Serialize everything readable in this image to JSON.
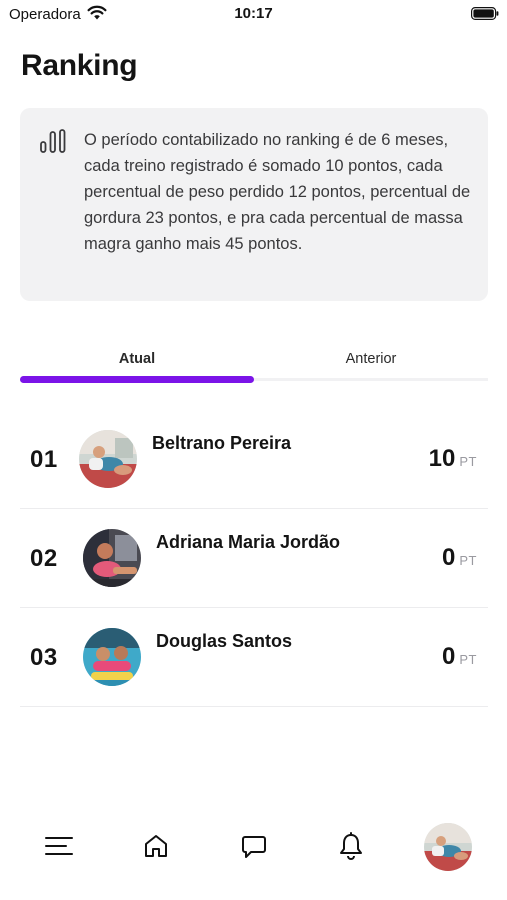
{
  "status_bar": {
    "carrier": "Operadora",
    "time": "10:17",
    "wifi_icon": "wifi-icon",
    "battery_icon": "battery-icon"
  },
  "page": {
    "title": "Ranking"
  },
  "info_card": {
    "icon": "bar-chart-icon",
    "text": "O período contabilizado no ranking é de 6 meses, cada treino registrado é somado 10 pontos, cada percentual de peso perdido 12 pontos, percentual de gordura 23 pontos, e pra cada percentual de massa magra ganho mais 45 pontos."
  },
  "tabs": {
    "current": "Atual",
    "previous": "Anterior",
    "active": "Atual"
  },
  "ranking": [
    {
      "position": "01",
      "name": "Beltrano Pereira",
      "points": "10",
      "unit": "PT"
    },
    {
      "position": "02",
      "name": "Adriana Maria Jordão",
      "points": "0",
      "unit": "PT"
    },
    {
      "position": "03",
      "name": "Douglas Santos",
      "points": "0",
      "unit": "PT"
    }
  ],
  "bottom_nav": {
    "items": [
      "menu-icon",
      "home-icon",
      "chat-icon",
      "bell-icon",
      "profile-avatar"
    ]
  },
  "colors": {
    "accent": "#7b14e8",
    "card_background": "#f2f2f3",
    "text_primary": "#141414",
    "text_muted": "#9a9aa0"
  }
}
